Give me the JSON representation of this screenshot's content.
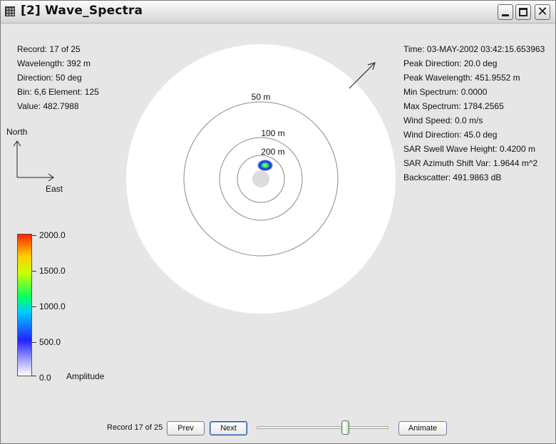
{
  "window": {
    "title": "[2] Wave_Spectra",
    "minimize_icon": "minimize-icon",
    "maximize_icon": "maximize-icon",
    "close_icon": "close-icon",
    "close_glyph": "✕"
  },
  "info_left": {
    "record": "Record: 17 of 25",
    "wavelength": "Wavelength: 392 m",
    "direction": "Direction: 50 deg",
    "bin": "Bin: 6,6 Element: 125",
    "value": "Value: 482.7988"
  },
  "info_right": {
    "time": "Time: 03-MAY-2002 03:42:15.653963",
    "peak_direction": "Peak Direction: 20.0 deg",
    "peak_wavelength": "Peak Wavelength: 451.9552 m",
    "min_spectrum": "Min Spectrum: 0.0000",
    "max_spectrum": "Max Spectrum: 1784.2565",
    "wind_speed": "Wind Speed: 0.0 m/s",
    "wind_direction": "Wind Direction: 45.0 deg",
    "sar_swell": "SAR Swell Wave Height: 0.4200 m",
    "sar_azimuth": "SAR Azimuth Shift Var: 1.9644 m^2",
    "backscatter": "Backscatter: 491.9863 dB"
  },
  "compass": {
    "north": "North",
    "east": "East"
  },
  "polar_plot": {
    "ring_labels": [
      "50 m",
      "100 m",
      "200 m"
    ],
    "wind_direction_deg": 45.0
  },
  "colorbar": {
    "labels": [
      "2000.0",
      "1500.0",
      "1000.0",
      "500.0",
      "0.0"
    ],
    "title": "Amplitude"
  },
  "controls": {
    "record_label": "Record 17 of 25",
    "prev_label": "Prev",
    "next_label": "Next",
    "animate_label": "Animate",
    "slider_value": 17,
    "slider_min": 1,
    "slider_max": 25
  },
  "colors": {
    "window_bg": "#e6e6e6",
    "plot_bg": "#ffffff",
    "ring": "#888888"
  }
}
